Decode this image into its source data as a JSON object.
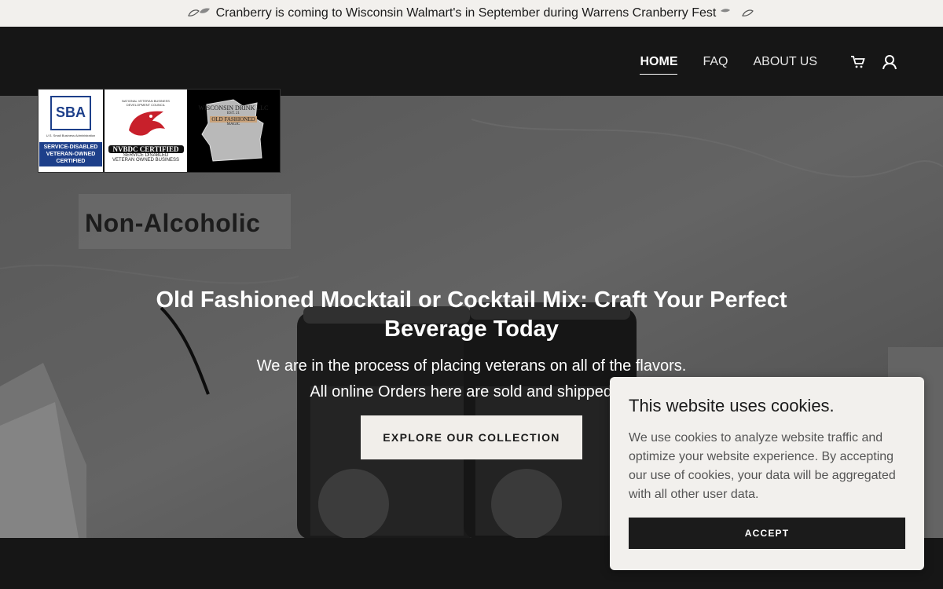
{
  "announcement": {
    "text": "Cranberry is coming to Wisconsin Walmart's in September during Warrens Cranberry Fest"
  },
  "nav": {
    "items": [
      {
        "label": "HOME",
        "active": true
      },
      {
        "label": "FAQ",
        "active": false
      },
      {
        "label": "ABOUT US",
        "active": false
      }
    ]
  },
  "icons": {
    "cart": "cart-icon",
    "account": "user-icon"
  },
  "badges": {
    "sba": {
      "logo": "SBA",
      "line1": "U.S. Small Business Administration",
      "cert": "SERVICE-DISABLED VETERAN-OWNED CERTIFIED"
    },
    "nvbdc": {
      "arc": "NATIONAL VETERAN BUSINESS DEVELOPMENT COUNCIL",
      "title": "NVBDC CERTIFIED",
      "sub1": "SERVICE DISABLED",
      "sub2": "VETERAN OWNED BUSINESS"
    },
    "wisconsin": {
      "name": "WISCONSIN DRINK LLC",
      "est": "EST. 21",
      "product": "OLD FASHIONED",
      "tag": "MAGIC"
    }
  },
  "hero": {
    "image_text": "Non-Alcoholic",
    "title": "Old Fashioned Mocktail or Cocktail Mix: Craft Your Perfect Beverage Today",
    "line1": "We are in the process of placing veterans on all of the flavors.",
    "line2": "All online Orders here are sold and shipped by",
    "cta": "EXPLORE OUR COLLECTION"
  },
  "cookie": {
    "title": "This website uses cookies.",
    "body": "We use cookies to analyze website traffic and optimize your website experience. By accepting our use of cookies, your data will be aggregated with all other user data.",
    "accept": "ACCEPT"
  },
  "colors": {
    "dark": "#161616",
    "light": "#f2f0ed"
  }
}
